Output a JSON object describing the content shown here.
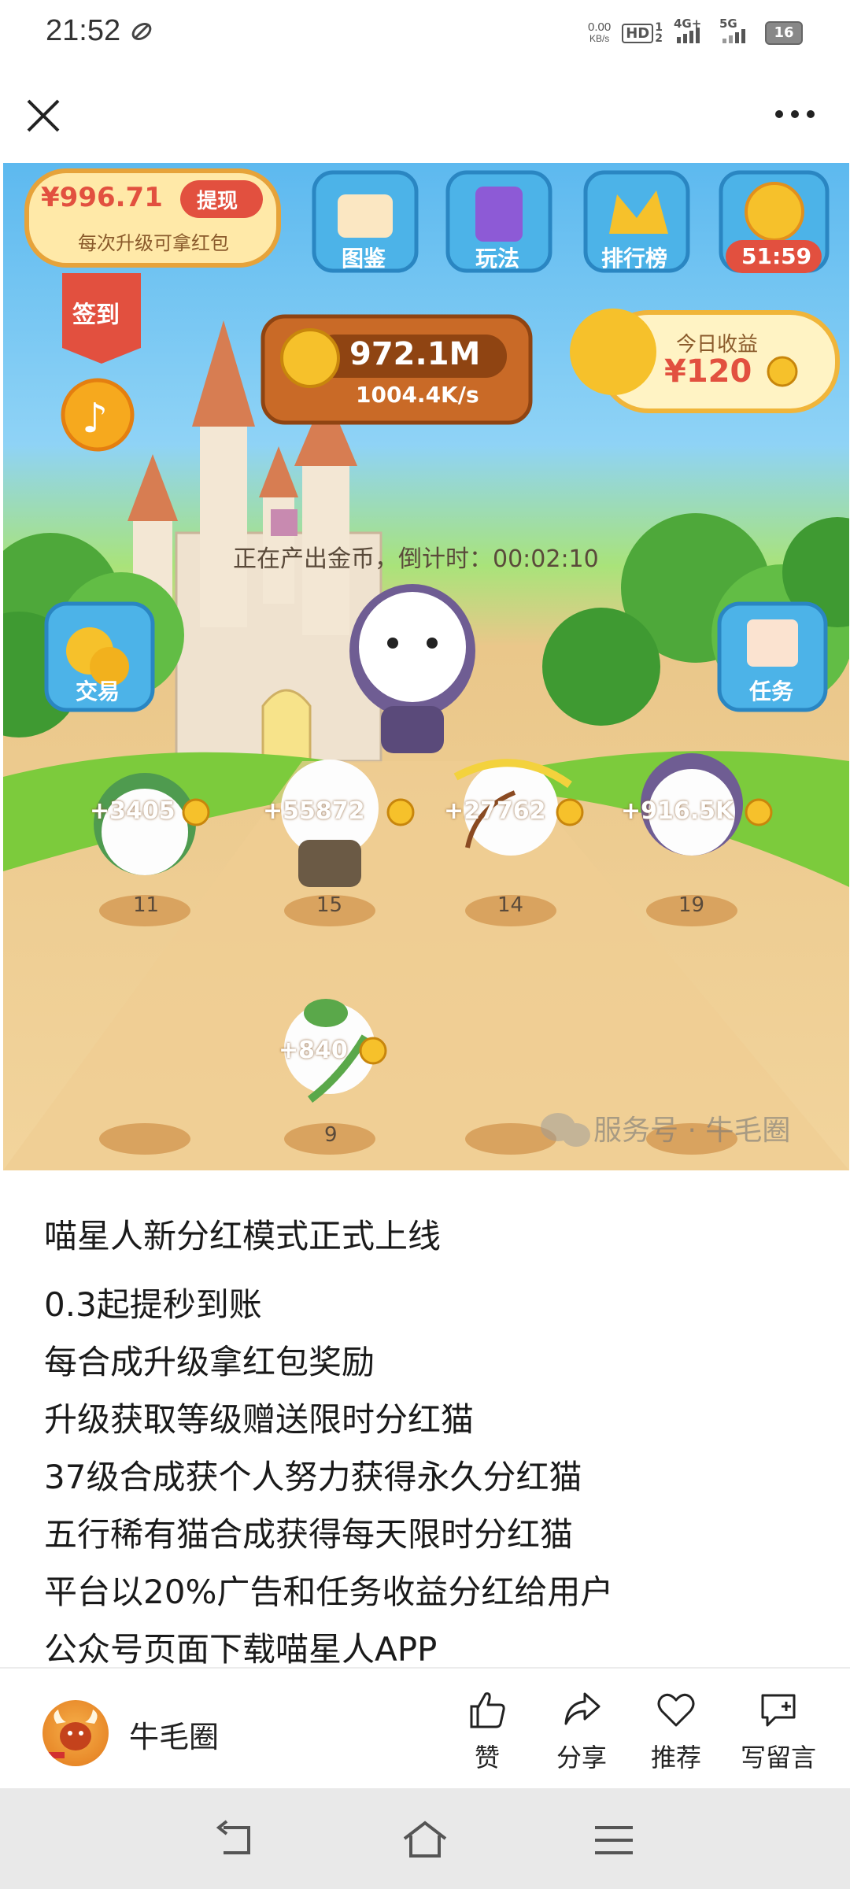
{
  "status_bar": {
    "time": "21:52",
    "net_speed_value": "0.00",
    "net_speed_unit": "KB/s",
    "hd_label": "HD",
    "sim1": "1",
    "sim2": "2",
    "net1": "4G+",
    "net2": "5G",
    "battery": "16"
  },
  "banner": {
    "red_packet_amount": "¥996.71",
    "withdraw_label": "提现",
    "red_packet_hint": "每次升级可拿红包",
    "menu": [
      {
        "label": "图鉴"
      },
      {
        "label": "玩法"
      },
      {
        "label": "排行榜"
      }
    ],
    "timer": "51:59",
    "checkin_label": "签到",
    "coins_total": "972.1M",
    "coins_rate": "1004.4K/s",
    "today_income_label": "今日收益",
    "today_income_value": "¥120",
    "producing_text": "正在产出金币，倒计时：00:02:10",
    "trade_label": "交易",
    "task_label": "任务",
    "cats": [
      {
        "gain": "+3405",
        "level": "11"
      },
      {
        "gain": "+55872",
        "level": "15"
      },
      {
        "gain": "+27762",
        "level": "14"
      },
      {
        "gain": "+916.5K",
        "level": "19"
      },
      {
        "gain": "+840",
        "level": "9"
      }
    ],
    "watermark": "服务号 · 牛毛圈"
  },
  "article": {
    "title": "喵星人新分红模式正式上线",
    "lines": [
      "0.3起提秒到账",
      "每合成升级拿红包奖励",
      "升级获取等级赠送限时分红猫",
      "37级合成获个人努力获得永久分红猫",
      "五行稀有猫合成获得每天限时分红猫",
      "平台以20%广告和任务收益分红给用户",
      "公众号页面下载喵星人APP"
    ]
  },
  "action_bar": {
    "author": "牛毛圈",
    "like": "赞",
    "share": "分享",
    "recommend": "推荐",
    "comment": "写留言"
  },
  "colors": {
    "accent_orange": "#e8801c",
    "coin_gold": "#f5c431",
    "sky": "#5db9ef",
    "ground": "#f2d49c"
  }
}
